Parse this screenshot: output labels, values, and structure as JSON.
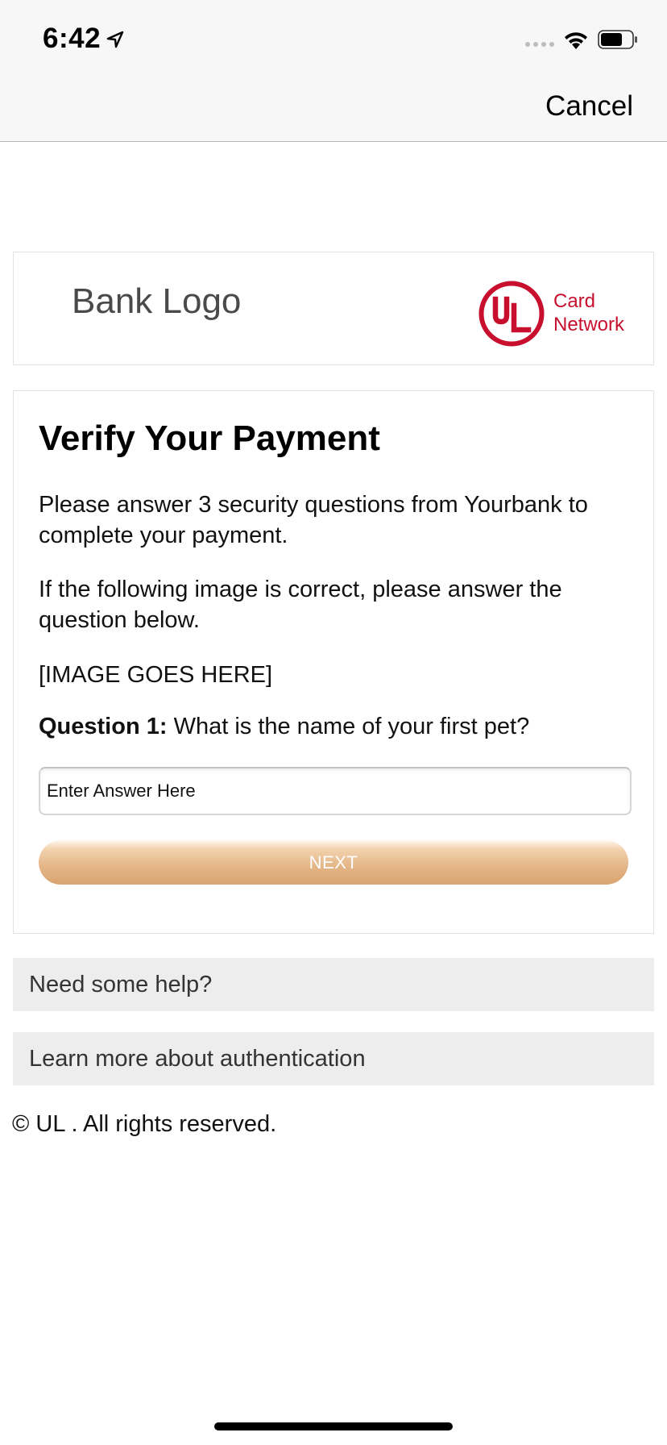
{
  "status_bar": {
    "time": "6:42",
    "icons": [
      "location-arrow-icon",
      "signal-icon",
      "wifi-icon",
      "battery-icon"
    ]
  },
  "nav": {
    "cancel_label": "Cancel"
  },
  "branding": {
    "bank_logo_text": "Bank Logo",
    "network_logo_line1": "Card",
    "network_logo_line2": "Network",
    "network_mark_text": "UL",
    "network_color": "#c8102e"
  },
  "verify": {
    "title": "Verify Your Payment",
    "paragraph1": "Please answer 3 security questions from Yourbank to complete your payment.",
    "paragraph2": "If the following image is correct, please answer the question below.",
    "image_placeholder": "[IMAGE GOES HERE]",
    "question_label": "Question 1:",
    "question_text": " What is the name of your first pet?",
    "answer_value": "",
    "answer_placeholder": "Enter Answer Here",
    "next_label": "NEXT",
    "button_color": "#dfad7c"
  },
  "help": {
    "need_help_label": "Need some help?",
    "learn_more_label": "Learn more about authentication"
  },
  "footer": {
    "copyright": "© UL . All rights reserved."
  }
}
